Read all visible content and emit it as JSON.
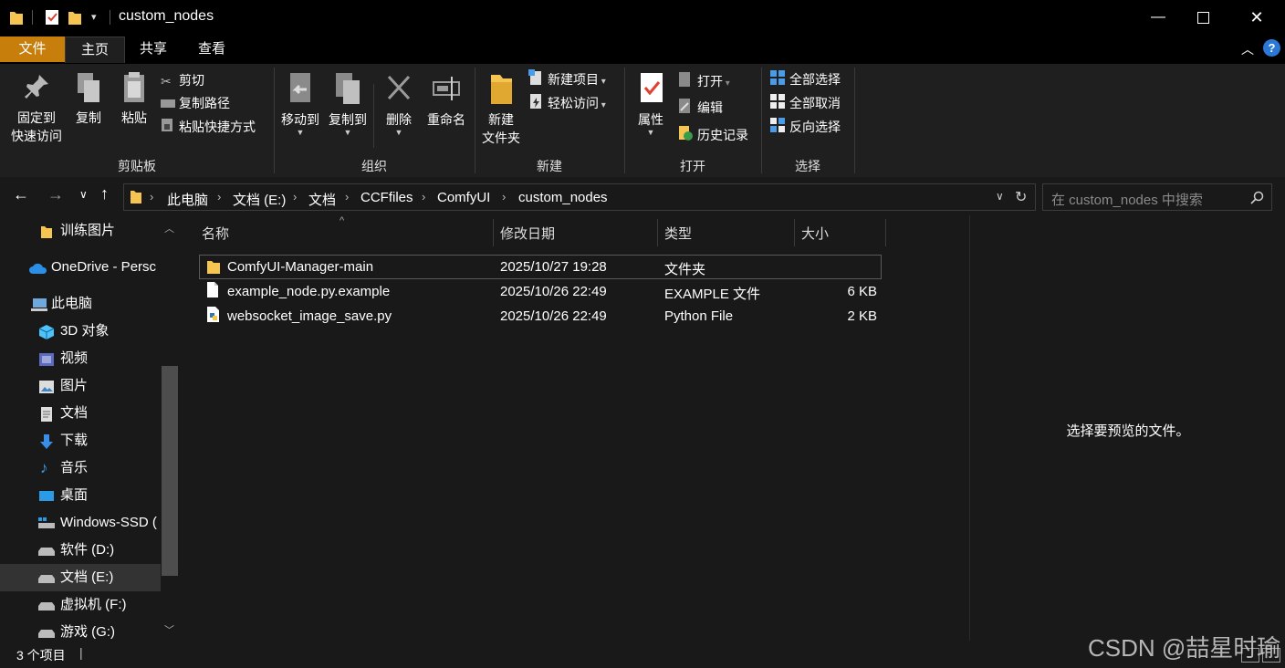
{
  "window": {
    "title": "custom_nodes"
  },
  "ribbon_tabs": {
    "file": "文件",
    "home": "主页",
    "share": "共享",
    "view": "查看"
  },
  "clipboard": {
    "pin_line1": "固定到",
    "pin_line2": "快速访问",
    "copy": "复制",
    "paste": "粘贴",
    "cut": "剪切",
    "copy_path": "复制路径",
    "paste_shortcut": "粘贴快捷方式",
    "label": "剪贴板"
  },
  "organize": {
    "move_to": "移动到",
    "copy_to": "复制到",
    "delete": "删除",
    "rename": "重命名",
    "label": "组织"
  },
  "new_group": {
    "new_folder_line1": "新建",
    "new_folder_line2": "文件夹",
    "new_item": "新建项目",
    "easy_access": "轻松访问",
    "label": "新建"
  },
  "open_group": {
    "properties": "属性",
    "open": "打开",
    "edit": "编辑",
    "history": "历史记录",
    "label": "打开"
  },
  "select_group": {
    "select_all": "全部选择",
    "select_none": "全部取消",
    "invert": "反向选择",
    "label": "选择"
  },
  "breadcrumb": [
    "此电脑",
    "文档 (E:)",
    "文档",
    "CCFfiles",
    "ComfyUI",
    "custom_nodes"
  ],
  "search": {
    "placeholder": "在 custom_nodes 中搜索"
  },
  "nav": [
    {
      "label": "训练图片",
      "icon": "folder-icon"
    },
    {
      "label": "OneDrive - Persc",
      "icon": "onedrive-icon"
    },
    {
      "label": "此电脑",
      "icon": "computer-icon"
    },
    {
      "label": "3D 对象",
      "icon": "3d-objects-icon"
    },
    {
      "label": "视频",
      "icon": "videos-icon"
    },
    {
      "label": "图片",
      "icon": "pictures-icon"
    },
    {
      "label": "文档",
      "icon": "documents-icon"
    },
    {
      "label": "下载",
      "icon": "downloads-icon"
    },
    {
      "label": "音乐",
      "icon": "music-icon"
    },
    {
      "label": "桌面",
      "icon": "desktop-icon"
    },
    {
      "label": "Windows-SSD (",
      "icon": "system-drive-icon"
    },
    {
      "label": "软件 (D:)",
      "icon": "drive-icon"
    },
    {
      "label": "文档 (E:)",
      "icon": "drive-icon"
    },
    {
      "label": "虚拟机 (F:)",
      "icon": "drive-icon"
    },
    {
      "label": "游戏 (G:)",
      "icon": "drive-icon"
    }
  ],
  "columns": {
    "name": "名称",
    "date": "修改日期",
    "type": "类型",
    "size": "大小"
  },
  "files": [
    {
      "name": "ComfyUI-Manager-main",
      "date": "2025/10/27 19:28",
      "type": "文件夹",
      "size": "",
      "icon": "folder-icon"
    },
    {
      "name": "example_node.py.example",
      "date": "2025/10/26 22:49",
      "type": "EXAMPLE 文件",
      "size": "6 KB",
      "icon": "file-icon"
    },
    {
      "name": "websocket_image_save.py",
      "date": "2025/10/26 22:49",
      "type": "Python File",
      "size": "2 KB",
      "icon": "python-file-icon"
    }
  ],
  "preview": {
    "message": "选择要预览的文件。"
  },
  "status": {
    "count": "3 个项目",
    "separator": "|"
  },
  "watermark": "CSDN @喆星时瑜",
  "colors": {
    "accent_file_tab": "#c77e0b",
    "folder": "#f5c451",
    "selection_border": "#5a5a5a",
    "background": "#191919"
  }
}
